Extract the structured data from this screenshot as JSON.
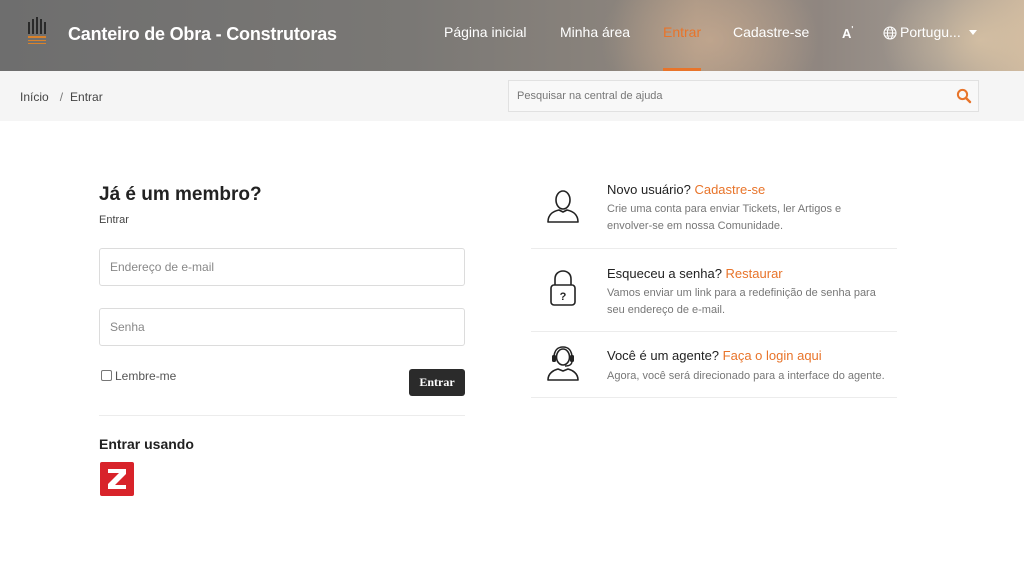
{
  "header": {
    "brand": "Canteiro de Obra - Construtoras",
    "nav": [
      {
        "label": "Página inicial"
      },
      {
        "label": "Minha área"
      },
      {
        "label": "Entrar"
      },
      {
        "label": "Cadastre-se"
      }
    ],
    "font_toggle": "A",
    "language": "Portugu..."
  },
  "breadcrumb": {
    "home": "Início",
    "separator": "/",
    "current": "Entrar"
  },
  "search": {
    "placeholder": "Pesquisar na central de ajuda"
  },
  "login": {
    "heading": "Já é um membro?",
    "subheading": "Entrar",
    "email_placeholder": "Endereço de e-mail",
    "password_placeholder": "Senha",
    "remember_label": "Lembre-me",
    "submit_label": "Entrar",
    "sso_heading": "Entrar usando"
  },
  "info": {
    "new_user": {
      "prefix": "Novo usuário? ",
      "link": "Cadastre-se",
      "desc": "Crie uma conta para enviar Tickets, ler Artigos e envolver-se em nossa Comunidade."
    },
    "forgot": {
      "prefix": "Esqueceu a senha? ",
      "link": "Restaurar",
      "desc": "Vamos enviar um link para a redefinição de senha para seu endereço de e-mail."
    },
    "agent": {
      "prefix": "Você é um agente? ",
      "link": "Faça o login aqui",
      "desc": "Agora, você será direcionado para a interface do agente."
    }
  },
  "colors": {
    "accent": "#e8742a",
    "button": "#2b2b2b",
    "sso_red": "#d8232a"
  }
}
